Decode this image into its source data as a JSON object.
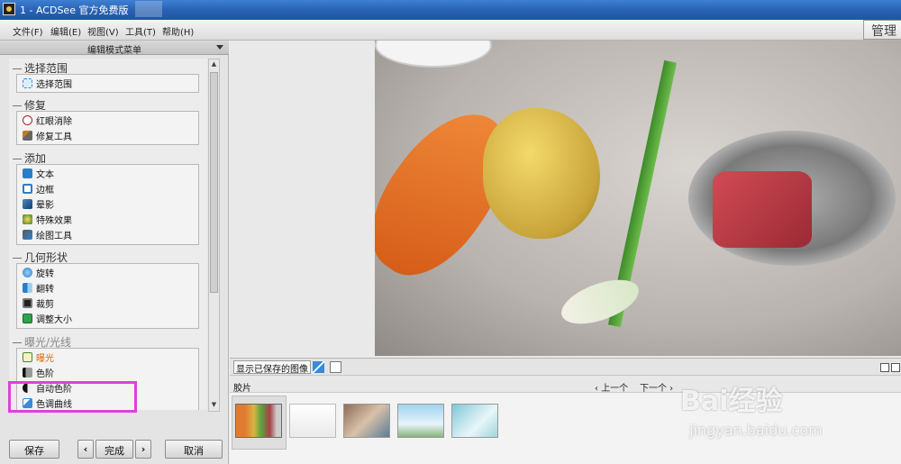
{
  "window": {
    "title": "1 - ACDSee 官方免费版"
  },
  "menubar": {
    "items": [
      "文件(F)",
      "编辑(E)",
      "视图(V)",
      "工具(T)",
      "帮助(H)"
    ],
    "manage_label": "管理"
  },
  "left_panel": {
    "header": "编辑模式菜单",
    "sections": [
      {
        "title": "选择范围",
        "items": [
          "选择范围"
        ]
      },
      {
        "title": "修复",
        "items": [
          "红眼消除",
          "修复工具"
        ]
      },
      {
        "title": "添加",
        "items": [
          "文本",
          "边框",
          "晕影",
          "特殊效果",
          "绘图工具"
        ]
      },
      {
        "title": "几何形状",
        "items": [
          "旋转",
          "翻转",
          "裁剪",
          "调整大小"
        ]
      },
      {
        "title": "曝光/光线",
        "items": [
          "曝光",
          "色阶",
          "自动色阶",
          "色调曲线"
        ]
      }
    ],
    "buttons": {
      "save": "保存",
      "prev": "‹",
      "done": "完成",
      "next": "›",
      "cancel": "取消"
    }
  },
  "right_panel": {
    "show_saved_label": "显示已保存的图像",
    "filmstrip_label": "胶片",
    "nav_prev": "上一个",
    "nav_next": "下一个"
  },
  "icons": {
    "select": "select-range-icon",
    "redeye": "red-eye-icon",
    "repair": "repair-tool-icon",
    "text": "text-icon",
    "frame": "frame-icon",
    "vignette": "vignette-icon",
    "effect": "special-effect-icon",
    "draw": "drawing-tool-icon",
    "rotate": "rotate-icon",
    "flip": "flip-icon",
    "crop": "crop-icon",
    "resize": "resize-icon",
    "exposure": "exposure-icon",
    "levels": "levels-icon",
    "auto_levels": "auto-levels-icon",
    "curve": "tone-curve-icon"
  },
  "colors": {
    "titlebar": "#2a63b3",
    "highlight": "#e040d8"
  },
  "watermark": {
    "main": "Bai经验",
    "sub": "jingyan.baidu.com"
  }
}
